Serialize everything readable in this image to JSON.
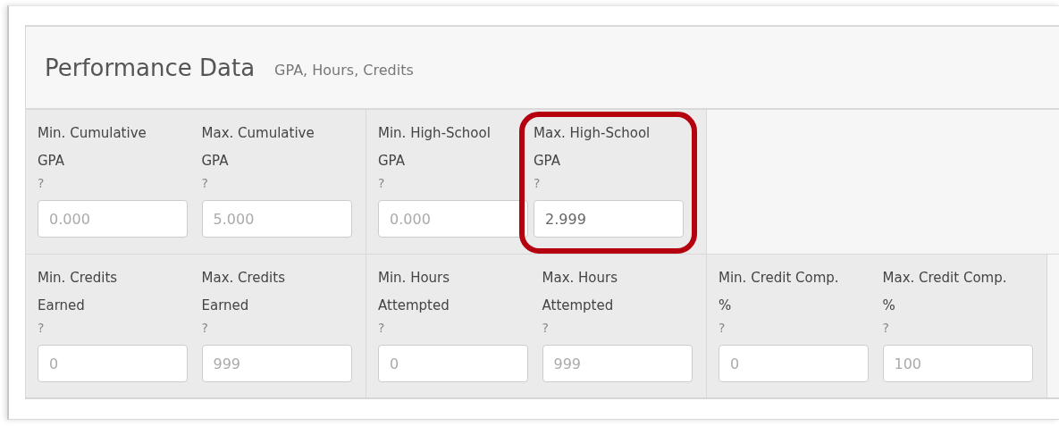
{
  "panel": {
    "title": "Performance Data",
    "subtitle": "GPA, Hours, Credits"
  },
  "rows": [
    {
      "groups": [
        {
          "fields": [
            {
              "label": "Min. Cumulative\nGPA",
              "help": "?",
              "placeholder": "0.000",
              "highlighted": false
            },
            {
              "label": "Max. Cumulative\nGPA",
              "help": "?",
              "placeholder": "5.000",
              "highlighted": false
            }
          ]
        },
        {
          "fields": [
            {
              "label": "Min. High-School\nGPA",
              "help": "?",
              "placeholder": "0.000",
              "highlighted": false
            },
            {
              "label": "Max. High-School\nGPA",
              "help": "?",
              "value": "2.999",
              "highlighted": true
            }
          ]
        }
      ]
    },
    {
      "groups": [
        {
          "fields": [
            {
              "label": "Min. Credits\nEarned",
              "help": "?",
              "placeholder": "0",
              "highlighted": false
            },
            {
              "label": "Max. Credits\nEarned",
              "help": "?",
              "placeholder": "999",
              "highlighted": false
            }
          ]
        },
        {
          "fields": [
            {
              "label": "Min. Hours\nAttempted",
              "help": "?",
              "placeholder": "0",
              "highlighted": false
            },
            {
              "label": "Max. Hours\nAttempted",
              "help": "?",
              "placeholder": "999",
              "highlighted": false
            }
          ]
        },
        {
          "fields": [
            {
              "label": "Min. Credit Comp.\n%",
              "help": "?",
              "placeholder": "0",
              "highlighted": false
            },
            {
              "label": "Max. Credit Comp.\n%",
              "help": "?",
              "placeholder": "100",
              "highlighted": false
            }
          ]
        }
      ]
    }
  ]
}
